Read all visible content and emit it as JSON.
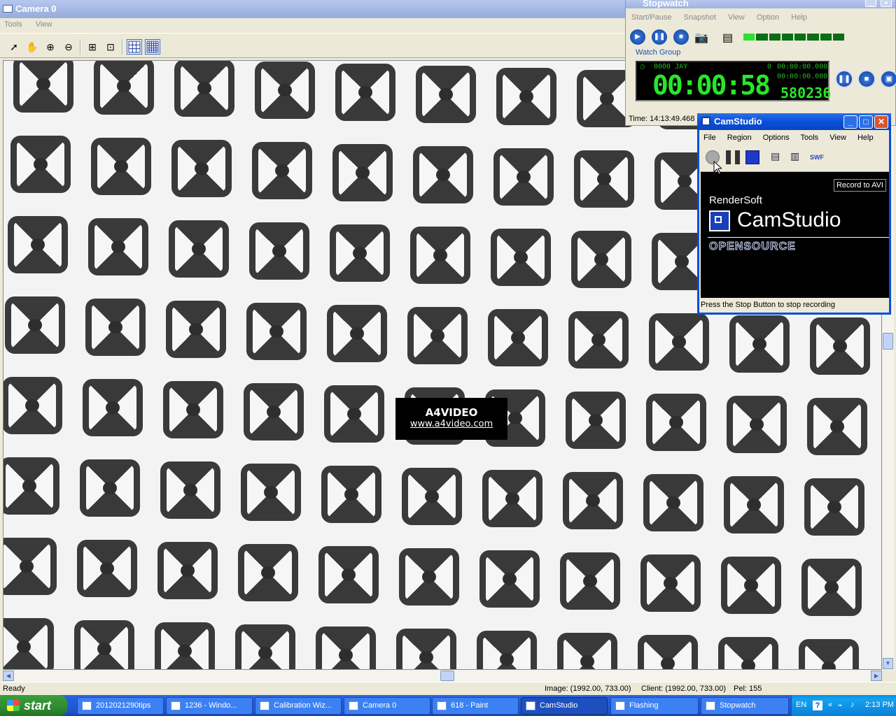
{
  "camera_window": {
    "title": "Camera 0",
    "menu": [
      "Tools",
      "View"
    ],
    "toolbar_icons": [
      "pointer-icon",
      "hand-icon",
      "zoom-in-icon",
      "zoom-out-icon",
      "zoom-region-icon",
      "zoom-fit-icon",
      "grid-icon",
      "fine-grid-icon"
    ],
    "status": {
      "ready": "Ready",
      "image": "Image: (1992.00, 733.00)",
      "client": "Client: (1992.00, 733.00)",
      "pel": "Pel: 155"
    },
    "watermark": {
      "title": "A4VIDEO",
      "url": "www.a4video.com"
    }
  },
  "stopwatch": {
    "title": "Stopwatch",
    "menu": [
      "Start/Pause",
      "Snapshot",
      "View",
      "Option",
      "Help"
    ],
    "group_label": "Watch Group",
    "display": {
      "top_left": "0000 JAY",
      "top_mid": "0",
      "top_right": "00:00:00.000",
      "mid_right": "00:00:00.000",
      "main": "00:00:58",
      "fraction": "580236"
    },
    "time": "Time: 14:13:49.468"
  },
  "camstudio": {
    "title": "CamStudio",
    "menu": [
      "File",
      "Region",
      "Options",
      "Tools",
      "View",
      "Help"
    ],
    "record_label": "Record to AVI",
    "vendor": "RenderSoft",
    "product": "CamStudio",
    "edition": "OPENSOURCE",
    "status": "Press the Stop Button to stop recording"
  },
  "taskbar": {
    "start_label": "start",
    "tasks": [
      {
        "label": "2012021290tips",
        "icon": "folder-icon"
      },
      {
        "label": "1236 - Windo...",
        "icon": "image-icon"
      },
      {
        "label": "Calibration Wiz...",
        "icon": "checker-icon"
      },
      {
        "label": "Camera 0",
        "icon": "window-icon"
      },
      {
        "label": "618 - Paint",
        "icon": "paint-icon"
      },
      {
        "label": "CamStudio",
        "icon": "camstudio-icon"
      },
      {
        "label": "Flashing",
        "icon": "window-icon"
      },
      {
        "label": "Stopwatch",
        "icon": "stopwatch-icon"
      }
    ],
    "tray": {
      "language": "EN",
      "clock": "2:13 PM"
    }
  },
  "colors": {
    "led_on": "#2fe030",
    "digit": "#27e827",
    "xp_blue": "#245edb"
  }
}
